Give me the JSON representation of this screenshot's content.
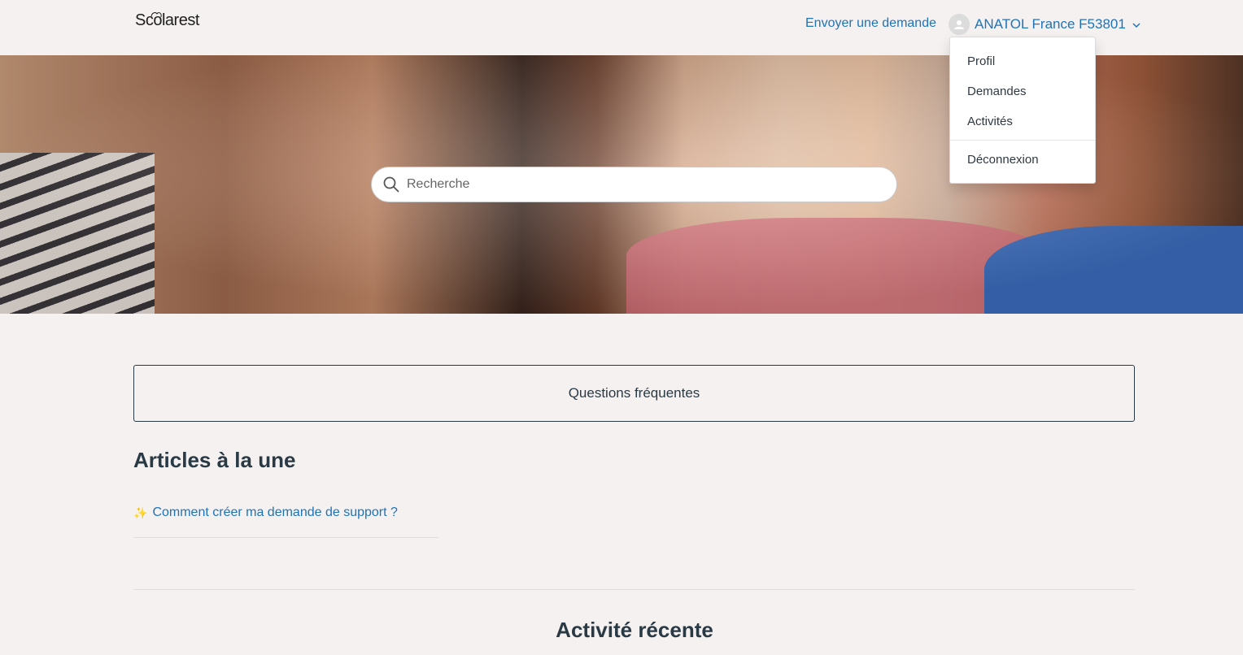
{
  "header": {
    "logo_text": "Scolarest",
    "submit_request": "Envoyer une demande",
    "user_name": "ANATOL France F53801"
  },
  "search": {
    "placeholder": "Recherche"
  },
  "user_menu": {
    "items": [
      "Profil",
      "Demandes",
      "Activités"
    ],
    "signout": "Déconnexion"
  },
  "faq": {
    "label": "Questions fréquentes"
  },
  "featured": {
    "title": "Articles à la une",
    "articles": [
      {
        "icon": "sparkle-icon",
        "label": "Comment créer ma demande de support ?"
      }
    ]
  },
  "recent": {
    "title": "Activité récente"
  },
  "colors": {
    "link": "#1f73b7",
    "text": "#2a3a45",
    "background": "#f5f1f0"
  }
}
